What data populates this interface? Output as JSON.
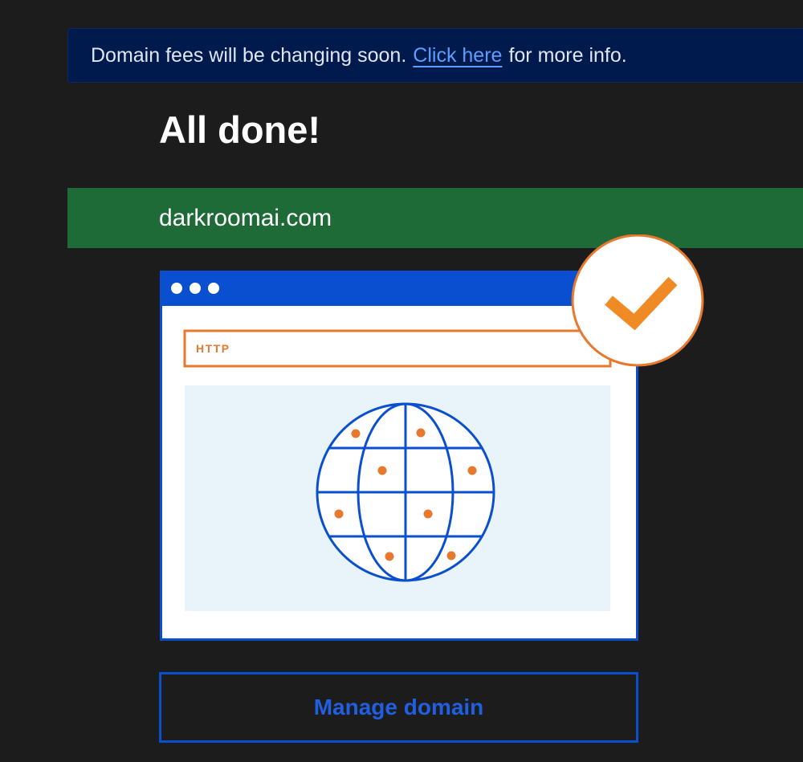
{
  "banner": {
    "text_before": "Domain fees will be changing soon.",
    "link_text": "Click here",
    "text_after": "for more info."
  },
  "title": "All done!",
  "domain": "darkroomai.com",
  "illustration": {
    "url_bar_text": "HTTP",
    "icons": [
      "window-dots-icon",
      "checkmark-icon",
      "globe-icon"
    ]
  },
  "manage_button": "Manage domain",
  "colors": {
    "background": "#1c1c1c",
    "banner_bg": "#001a4d",
    "link": "#5c9dff",
    "success_bar": "#1e6b38",
    "accent_blue": "#0a4fcf",
    "accent_orange": "#e8782e"
  }
}
